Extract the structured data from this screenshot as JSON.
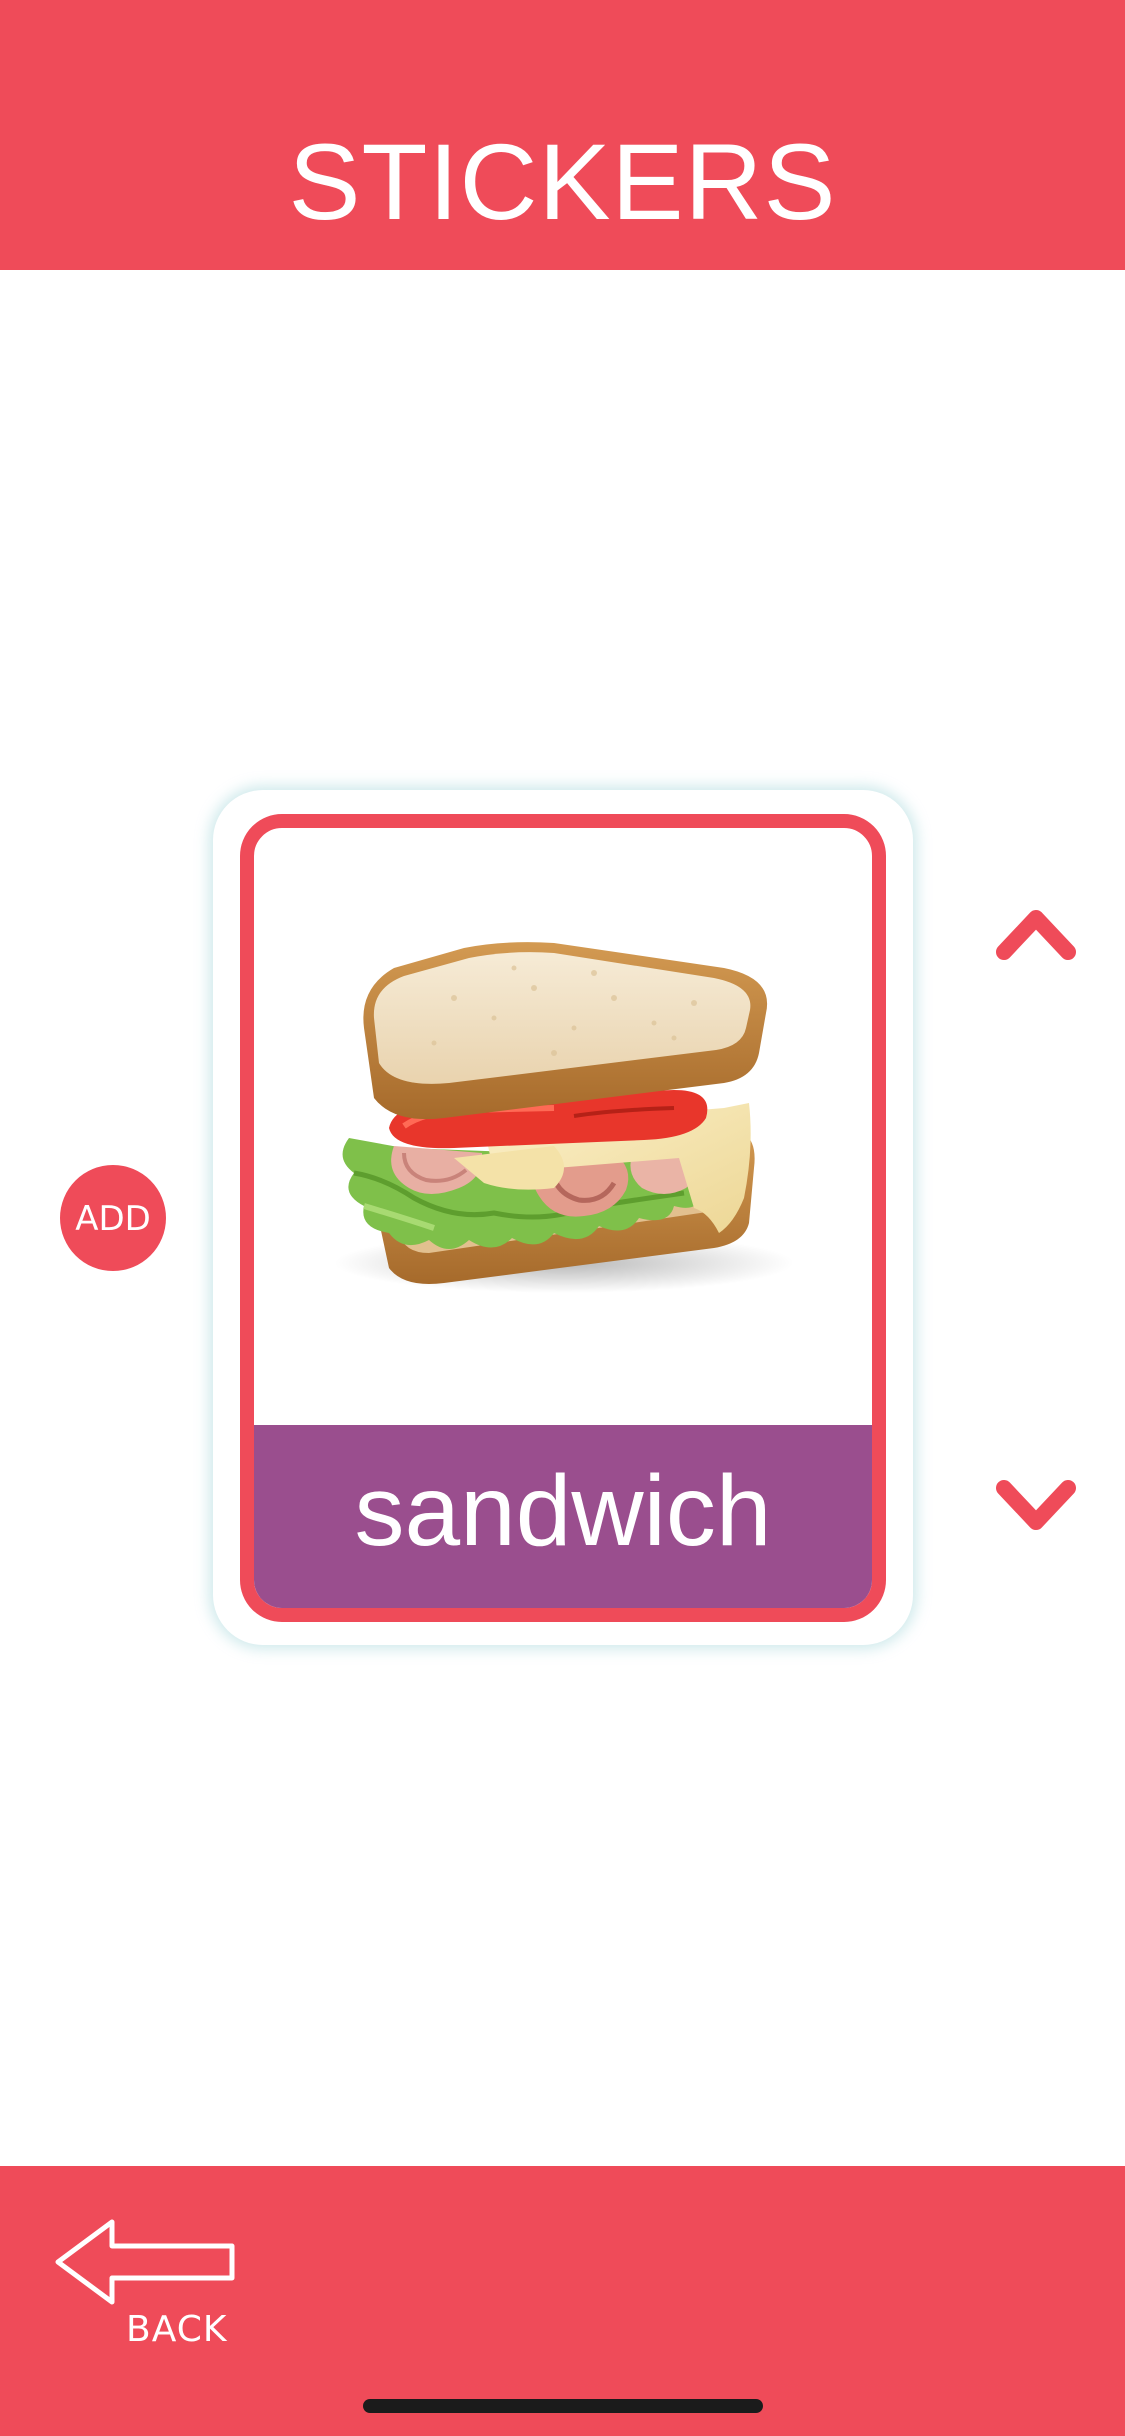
{
  "header": {
    "title": "STICKERS"
  },
  "card": {
    "label": "sandwich",
    "image_icon": "sandwich-photo",
    "frame_color": "#EF4B59",
    "label_bar_color": "#9A4E8E"
  },
  "controls": {
    "add_label": "ADD",
    "up_icon": "chevron-up-icon",
    "down_icon": "chevron-down-icon"
  },
  "footer": {
    "back_label": "BACK",
    "back_icon": "arrow-left-icon"
  },
  "colors": {
    "accent": "#EF4B59",
    "label_bar": "#9A4E8E",
    "background": "#FFFFFF"
  }
}
